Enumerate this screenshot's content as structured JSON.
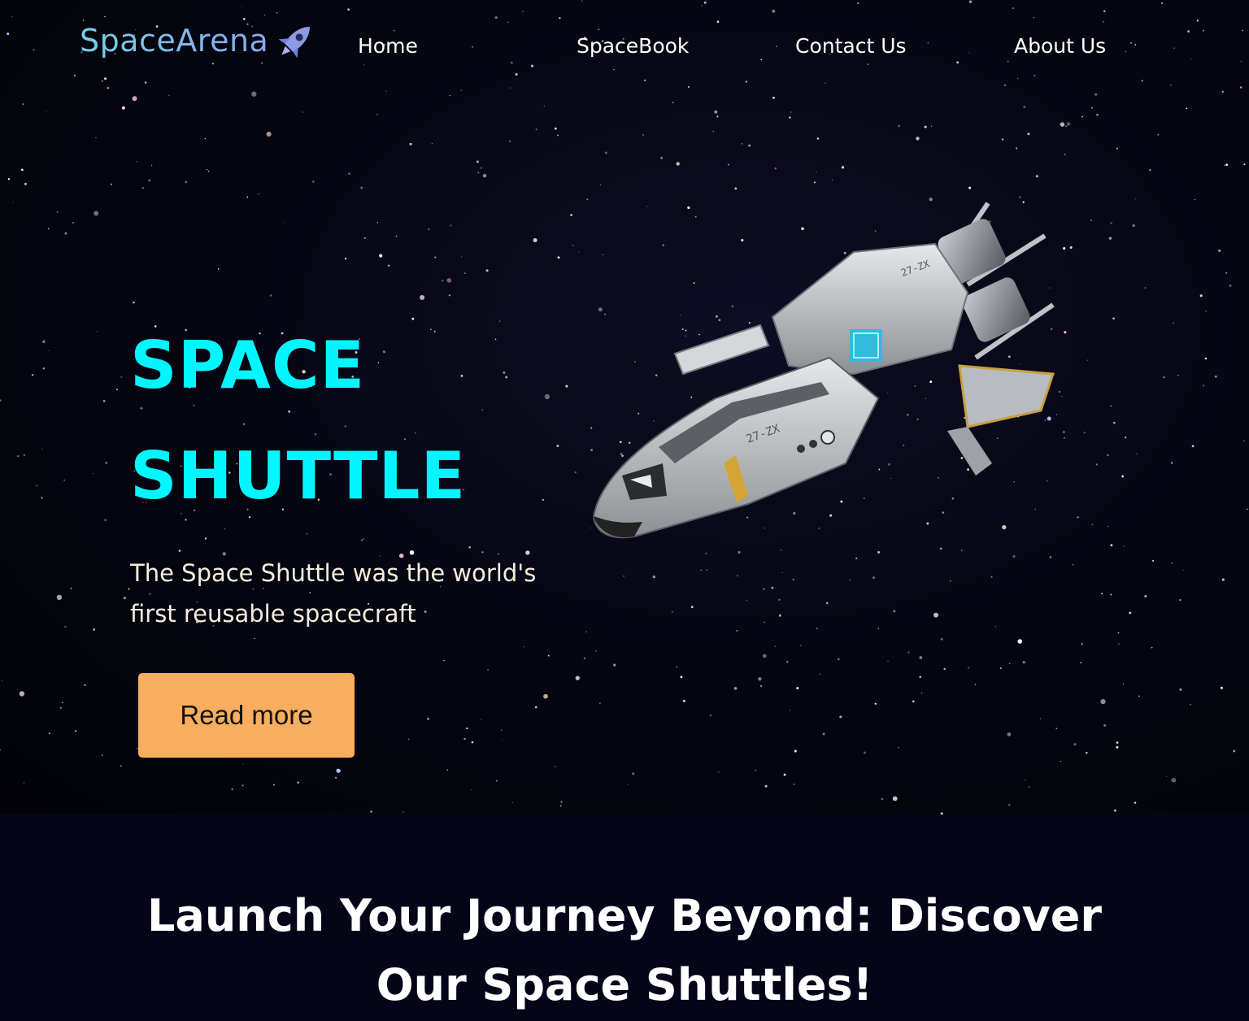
{
  "brand": {
    "name": "SpaceArena",
    "icon": "rocket-icon"
  },
  "nav": {
    "items": [
      {
        "label": "Home"
      },
      {
        "label": "SpaceBook"
      },
      {
        "label": "Contact Us"
      },
      {
        "label": "About Us"
      }
    ]
  },
  "hero": {
    "title_line1": "SPACE",
    "title_line2": "SHUTTLE",
    "description": "The Space Shuttle was the world's first reusable spacecraft",
    "button_label": "Read more",
    "image": "spaceship-illustration"
  },
  "section": {
    "title": "Launch Your Journey Beyond: Discover Our Space Shuttles!"
  },
  "colors": {
    "hero_title": "#00f7ff",
    "button_bg": "#f8ae5e",
    "background": "#05051a"
  }
}
